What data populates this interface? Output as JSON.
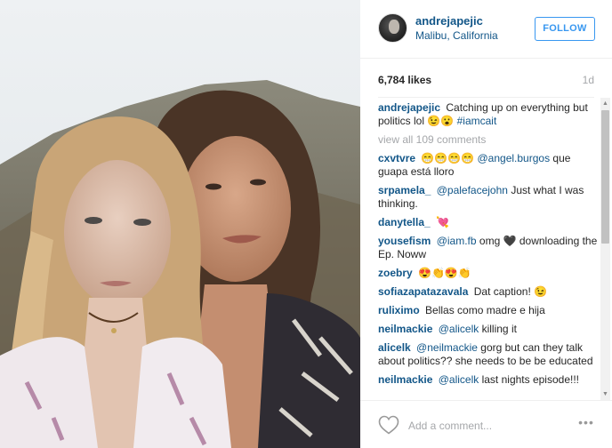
{
  "post": {
    "username": "andrejapejic",
    "location": "Malibu, California",
    "follow_label": "FOLLOW",
    "likes": "6,784 likes",
    "age": "1d"
  },
  "comments": {
    "caption_user": "andrejapejic",
    "caption_text": "Catching up on everything but politics lol",
    "caption_emoji": "😉😮",
    "caption_tag": "#iamcait",
    "view_all": "view all 109 comments",
    "items": [
      {
        "user": "cxvtvre",
        "pre": "😁😁😁😁",
        "mention": "@angel.burgos",
        "text": "que guapa está lloro"
      },
      {
        "user": "srpamela_",
        "pre": "",
        "mention": "@palefacejohn",
        "text": "Just what I was thinking."
      },
      {
        "user": "danytella_",
        "pre": "💘",
        "mention": "",
        "text": ""
      },
      {
        "user": "yousefism",
        "pre": "",
        "mention": "@iam.fb",
        "text": "omg 🖤 downloading the Ep. Noww"
      },
      {
        "user": "zoebry",
        "pre": "😍👏😍👏",
        "mention": "",
        "text": ""
      },
      {
        "user": "sofiazapatazavala",
        "pre": "",
        "mention": "",
        "text": "Dat caption! 😉"
      },
      {
        "user": "ruliximo",
        "pre": "",
        "mention": "",
        "text": "Bellas como madre e hija"
      },
      {
        "user": "neilmackie",
        "pre": "",
        "mention": "@alicelk",
        "text": "killing it"
      },
      {
        "user": "alicelk",
        "pre": "",
        "mention": "@neilmackie",
        "text": "gorg but can they talk about politics?? she needs to be be educated"
      },
      {
        "user": "neilmackie",
        "pre": "",
        "mention": "@alicelk",
        "text": "last nights episode!!!"
      }
    ]
  },
  "footer": {
    "placeholder": "Add a comment...",
    "more": "•••"
  },
  "icons": {
    "like": "heart-icon",
    "options": "more-options-icon"
  },
  "colors": {
    "link": "#125688",
    "follow": "#3897f0",
    "muted": "#a5a7aa"
  }
}
